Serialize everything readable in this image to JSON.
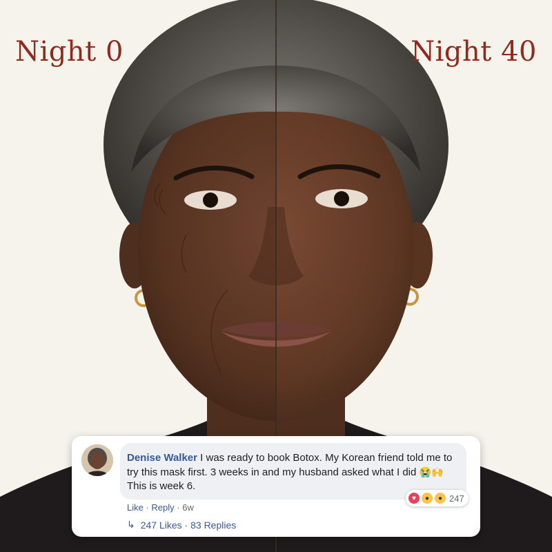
{
  "labels": {
    "left": "Night 0",
    "right": "Night 40"
  },
  "comment": {
    "author": "Denise Walker",
    "text": "I was ready to book Botox. My Korean friend told me to try this mask first. 3 weeks in and my husband asked what I did",
    "emojis": "😭🙌",
    "text_after": "This is week 6.",
    "reaction_count": "247",
    "actions": {
      "like": "Like",
      "separator": " · ",
      "reply": "Reply",
      "age": "6w"
    },
    "summary": "247 Likes · 83 Replies"
  },
  "colors": {
    "label": "#8e2b1f",
    "author": "#385898",
    "bubble": "#eef0f3",
    "background": "#f6f2ec"
  }
}
